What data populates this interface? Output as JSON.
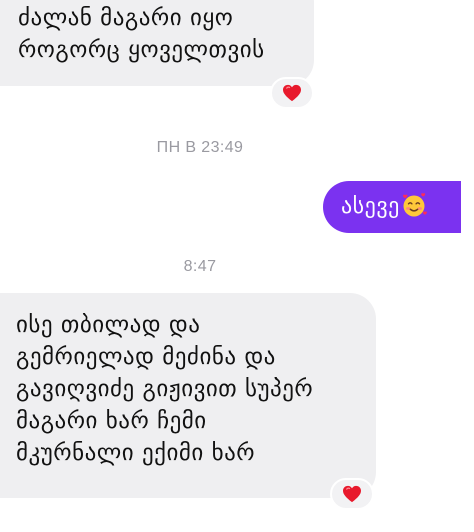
{
  "messages": [
    {
      "direction": "incoming",
      "lines": [
        "ძალან მაგარი იყო",
        "როგორც ყოველთვის"
      ],
      "reaction": "red-heart-icon"
    },
    {
      "type": "timestamp",
      "text": "ПН В 23:49"
    },
    {
      "direction": "outgoing",
      "text": "ასევე",
      "emoji": "smiling-face-with-hearts-icon"
    },
    {
      "type": "timestamp",
      "text": "8:47"
    },
    {
      "direction": "incoming",
      "lines": [
        "ისე თბილად და",
        "გემრიელად მეძინა და",
        "გავიღვიძე გიჟივით სუპერ",
        "მაგარი ხარ ჩემი",
        "მკურნალი ექიმი ხარ"
      ],
      "reaction": "red-heart-icon"
    }
  ],
  "colors": {
    "incoming_bubble": "#efeff1",
    "outgoing_bubble": "#7b32f0",
    "timestamp_text": "#9a9aa1",
    "heart": "#e8192c"
  }
}
